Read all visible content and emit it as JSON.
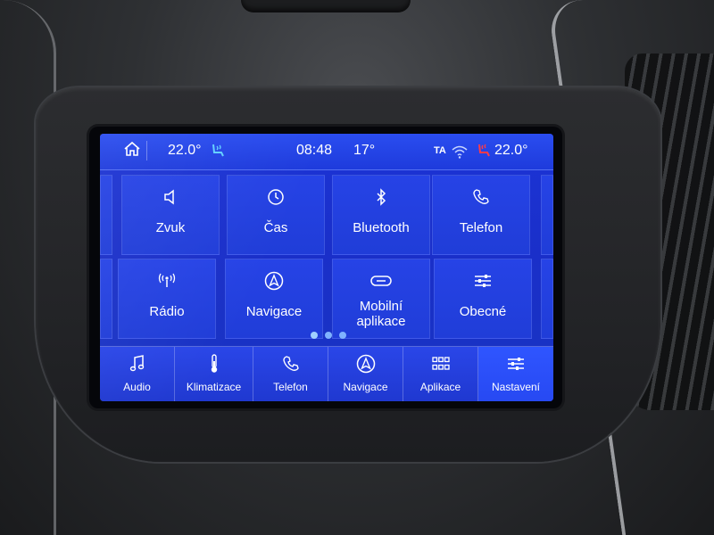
{
  "status_bar": {
    "left_temp": "22.0°",
    "time": "08:48",
    "outside_temp": "17°",
    "ta_label": "TA",
    "right_temp": "22.0°",
    "icons": [
      "home-icon",
      "seat-ventilation-icon",
      "wifi-icon",
      "seat-heat-icon"
    ]
  },
  "tiles": [
    {
      "label": "Zvuk",
      "icon": "speaker-icon"
    },
    {
      "label": "Čas",
      "icon": "clock-icon"
    },
    {
      "label": "Bluetooth",
      "icon": "bluetooth-icon"
    },
    {
      "label": "Telefon",
      "icon": "phone-icon"
    },
    {
      "label": "Rádio",
      "icon": "radio-antenna-icon"
    },
    {
      "label": "Navigace",
      "icon": "navigation-icon"
    },
    {
      "label": "Mobilní aplikace",
      "icon": "mobile-apps-icon"
    },
    {
      "label": "Obecné",
      "icon": "sliders-icon"
    }
  ],
  "page_indicator": {
    "count": 3,
    "active": 1
  },
  "bottom_nav": [
    {
      "label": "Audio",
      "icon": "music-note-icon",
      "active": false
    },
    {
      "label": "Klimatizace",
      "icon": "thermometer-icon",
      "active": false
    },
    {
      "label": "Telefon",
      "icon": "phone-icon",
      "active": false
    },
    {
      "label": "Navigace",
      "icon": "navigation-icon",
      "active": false
    },
    {
      "label": "Aplikace",
      "icon": "grid-icon",
      "active": false
    },
    {
      "label": "Nastavení",
      "icon": "settings-sliders-icon",
      "active": true
    }
  ],
  "colors": {
    "screen_blue": "#1c34d6",
    "accent_light_blue": "#9fd0ff",
    "seat_heat_red": "#ff3b4a",
    "seat_vent_blue": "#62d0ff"
  }
}
